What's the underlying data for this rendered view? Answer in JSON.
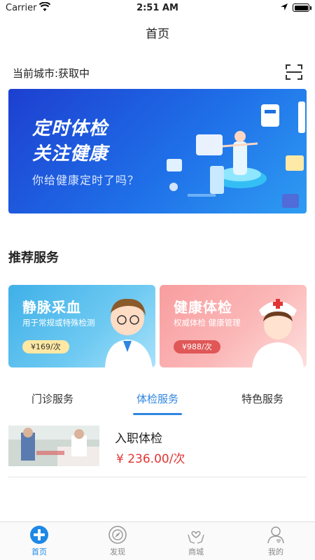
{
  "status_bar": {
    "carrier": "Carrier",
    "time": "2:51 AM"
  },
  "nav": {
    "title": "首页"
  },
  "city": {
    "label": "当前城市:获取中"
  },
  "banner": {
    "line1": "定时体检",
    "line2": "关注健康",
    "line3": "你给健康定时了吗？"
  },
  "recommend": {
    "title": "推荐服务",
    "cards": [
      {
        "title": "静脉采血",
        "subtitle": "用于常规或特殊检测",
        "price": "¥169/次"
      },
      {
        "title": "健康体检",
        "subtitle": "权威体检  健康管理",
        "price": "¥988/次"
      }
    ]
  },
  "tabs": [
    "门诊服务",
    "体检服务",
    "特色服务"
  ],
  "active_tab": 1,
  "list": [
    {
      "name": "入职体检",
      "price": "¥ 236.00/次"
    }
  ],
  "tabbar": {
    "items": [
      {
        "label": "首页",
        "icon": "plus-circle-icon"
      },
      {
        "label": "发现",
        "icon": "compass-icon"
      },
      {
        "label": "商城",
        "icon": "heart-hands-icon"
      },
      {
        "label": "我的",
        "icon": "person-icon"
      }
    ]
  },
  "colors": {
    "accent": "#2f86e0",
    "price": "#e03535",
    "banner": "#1f6fe8"
  }
}
